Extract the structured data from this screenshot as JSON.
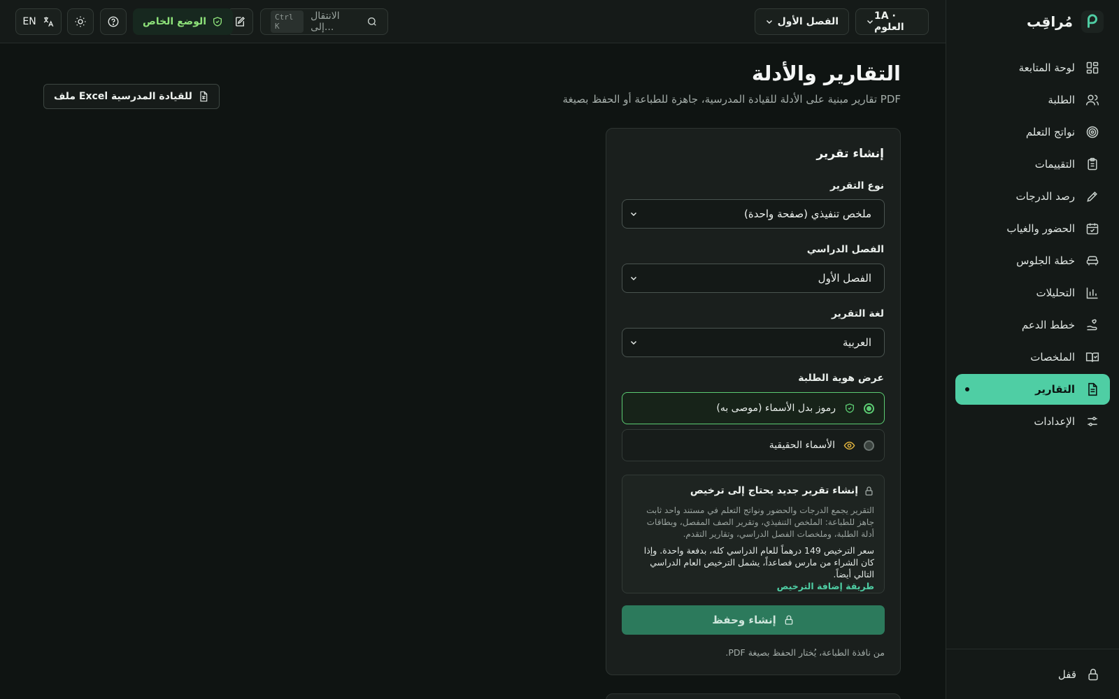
{
  "brand": {
    "name": "مُراقِب"
  },
  "sidebar": {
    "items": [
      {
        "label": "لوحة المتابعة",
        "icon": "dashboard-icon"
      },
      {
        "label": "الطلبة",
        "icon": "users-icon"
      },
      {
        "label": "نواتج التعلم",
        "icon": "target-icon"
      },
      {
        "label": "التقييمات",
        "icon": "clipboard-icon"
      },
      {
        "label": "رصد الدرجات",
        "icon": "pencil-icon"
      },
      {
        "label": "الحضور والغياب",
        "icon": "calendar-check-icon"
      },
      {
        "label": "خطة الجلوس",
        "icon": "seat-icon"
      },
      {
        "label": "التحليلات",
        "icon": "bar-chart-icon"
      },
      {
        "label": "خطط الدعم",
        "icon": "hand-heart-icon"
      },
      {
        "label": "الملخصات",
        "icon": "book-check-icon"
      },
      {
        "label": "التقارير",
        "icon": "file-text-icon",
        "active": true
      },
      {
        "label": "الإعدادات",
        "icon": "sliders-icon"
      }
    ],
    "lock_label": "قفل"
  },
  "topbar": {
    "class_select": "1A · العلوم",
    "term_select": "الفصل الأول",
    "search_placeholder": "الانتقال إلى...",
    "search_shortcut": "Ctrl K",
    "privacy_badge": "الوضع الخاص",
    "language_label": "EN"
  },
  "page": {
    "title": "التقارير والأدلة",
    "subtitle": "تقارير مبنية على الأدلة للقيادة المدرسية، جاهزة للطباعة أو الحفظ بصيغة PDF",
    "excel_button": "ملف Excel للقيادة المدرسية"
  },
  "form": {
    "title": "إنشاء تقرير",
    "report_type_label": "نوع التقرير",
    "report_type_value": "ملخص تنفيذي (صفحة واحدة)",
    "term_label": "الفصل الدراسي",
    "term_value": "الفصل الأول",
    "language_label": "لغة التقرير",
    "language_value": "العربية",
    "identity_label": "عرض هوية الطلبة",
    "identity_options": [
      {
        "label": "رموز بدل الأسماء (موصى به)",
        "selected": true
      },
      {
        "label": "الأسماء الحقيقية",
        "selected": false
      }
    ],
    "license": {
      "title": "إنشاء تقرير جديد يحتاج إلى ترخيص",
      "body": "التقرير يجمع الدرجات والحضور ونواتج التعلم في مستند واحد ثابت جاهز للطباعة: الملخص التنفيذي، وتقرير الصف المفصل، وبطاقات أدلة الطلبة، وملخصات الفصل الدراسي، وتقارير التقدم.",
      "price": "سعر الترخيص 149 درهماً للعام الدراسي كله، بدفعة واحدة. وإذا كان الشراء من مارس فصاعداً، يشمل الترخيص العام الدراسي التالي أيضاً.",
      "link": "طريقة إضافة الترخيص"
    },
    "create_button": "إنشاء وحفظ",
    "footnote": "من نافذة الطباعة، يُختار الحفظ بصيغة PDF."
  }
}
